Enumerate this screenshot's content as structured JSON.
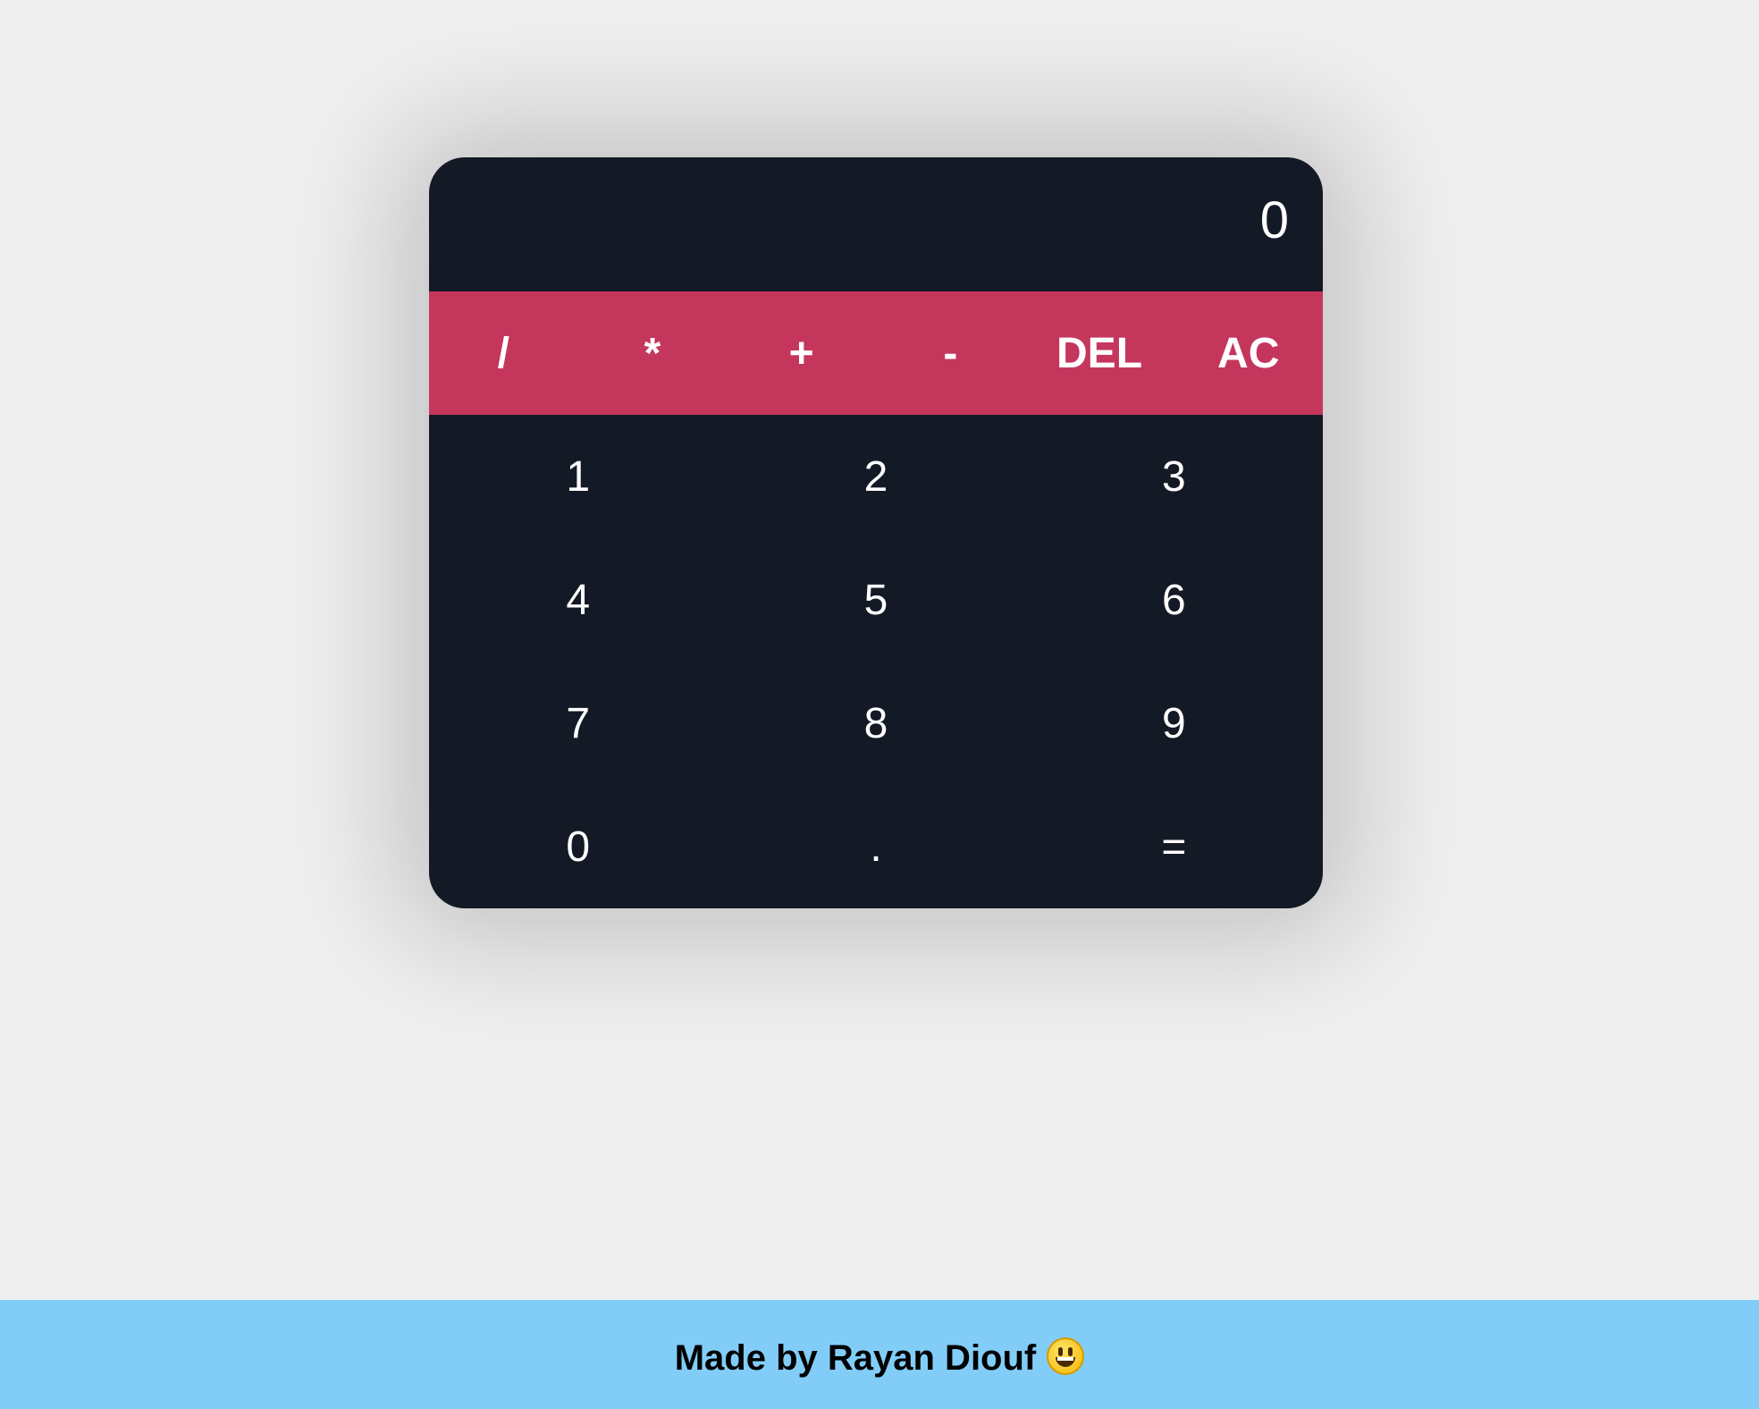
{
  "calculator": {
    "display": "0",
    "operators": [
      "/",
      "*",
      "+",
      "-",
      "DEL",
      "AC"
    ],
    "digits": [
      "1",
      "2",
      "3",
      "4",
      "5",
      "6",
      "7",
      "8",
      "9",
      "0",
      ".",
      "="
    ]
  },
  "footer": {
    "text": "Made by Rayan Diouf",
    "emoji_icon": "smiley-emoji-icon"
  },
  "colors": {
    "background": "#efefef",
    "calculator_body": "#141926",
    "operator_bar": "#c5365d",
    "footer": "#81cdf8"
  }
}
